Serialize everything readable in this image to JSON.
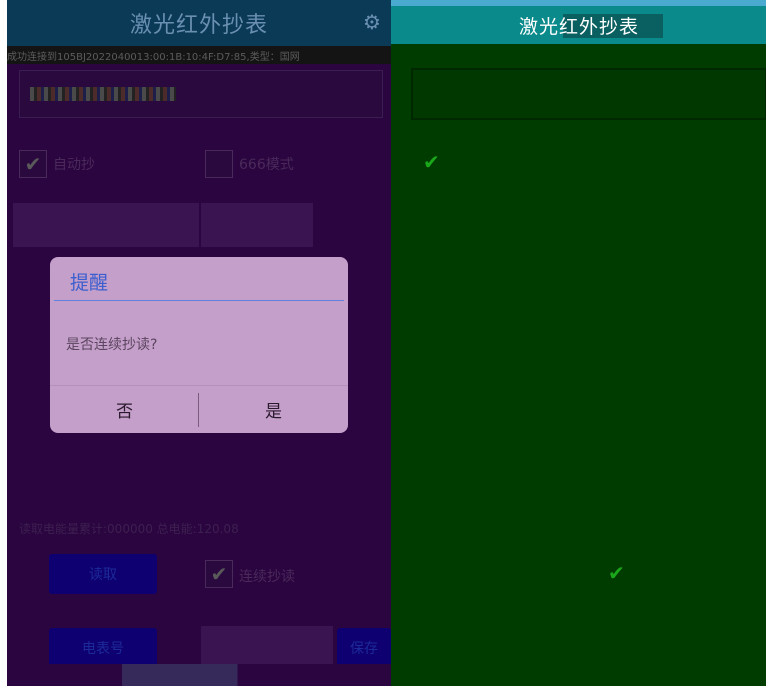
{
  "left": {
    "title": "激光红外抄表",
    "connection_status": "成功连接到105BJ2022040013:00:1B:10:4F:D7:85,类型：国网",
    "option_left_label": "自动抄",
    "option_right_label": "666模式",
    "btn_a": "",
    "btn_b": "",
    "status_text": "读取电能量累计:000000 总电能:120.08",
    "read_button": "读取",
    "continuous_label": "连续抄读",
    "bottom_btn_1": "电表号",
    "bottom_btn_2": "",
    "bottom_btn_3": "保存"
  },
  "dialog": {
    "title": "提醒",
    "message": "是否连续抄读?",
    "cancel": "否",
    "confirm": "是"
  },
  "right": {
    "title": "激光红外抄表"
  },
  "colors": {
    "dialog_bg": "#c49fc9",
    "dialog_title": "#3c5fcf",
    "right_bg": "#003b00",
    "left_bg": "#2a0540",
    "check": "#1aa81a"
  },
  "icons": {
    "settings": "gear-icon",
    "check": "check-icon"
  }
}
